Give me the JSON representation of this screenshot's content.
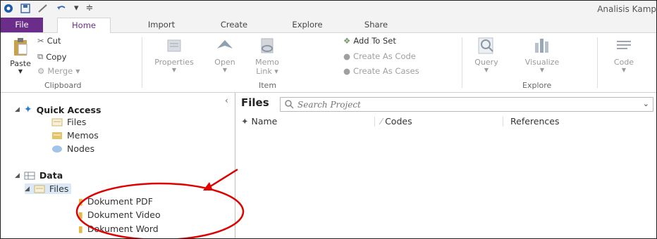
{
  "window": {
    "title": "Analisis Kamp"
  },
  "tabs": [
    {
      "label": "File"
    },
    {
      "label": "Home"
    },
    {
      "label": "Import"
    },
    {
      "label": "Create"
    },
    {
      "label": "Explore"
    },
    {
      "label": "Share"
    }
  ],
  "ribbon": {
    "clipboard": {
      "paste": "Paste",
      "cut": "Cut",
      "copy": "Copy",
      "merge": "Merge",
      "group": "Clipboard"
    },
    "item": {
      "properties": "Properties",
      "open": "Open",
      "memo": "Memo",
      "memo_link": "Link",
      "group": "Item"
    },
    "set": {
      "add_to_set": "Add To Set",
      "create_as_code": "Create As Code",
      "create_as_cases": "Create As Cases"
    },
    "explore": {
      "query": "Query",
      "visualize": "Visualize",
      "code": "Code",
      "group": "Explore"
    }
  },
  "nav": {
    "quick_access": "Quick Access",
    "quick_items": [
      "Files",
      "Memos",
      "Nodes"
    ],
    "data": "Data",
    "files": "Files",
    "folders": [
      "Dokument PDF",
      "Dokument Video",
      "Dokument Word"
    ]
  },
  "panel": {
    "title": "Files",
    "search_placeholder": "Search Project",
    "columns": [
      "Name",
      "Codes",
      "References"
    ]
  },
  "colors": {
    "file_tab": "#6a2e8a",
    "annotation": "#e00000"
  }
}
